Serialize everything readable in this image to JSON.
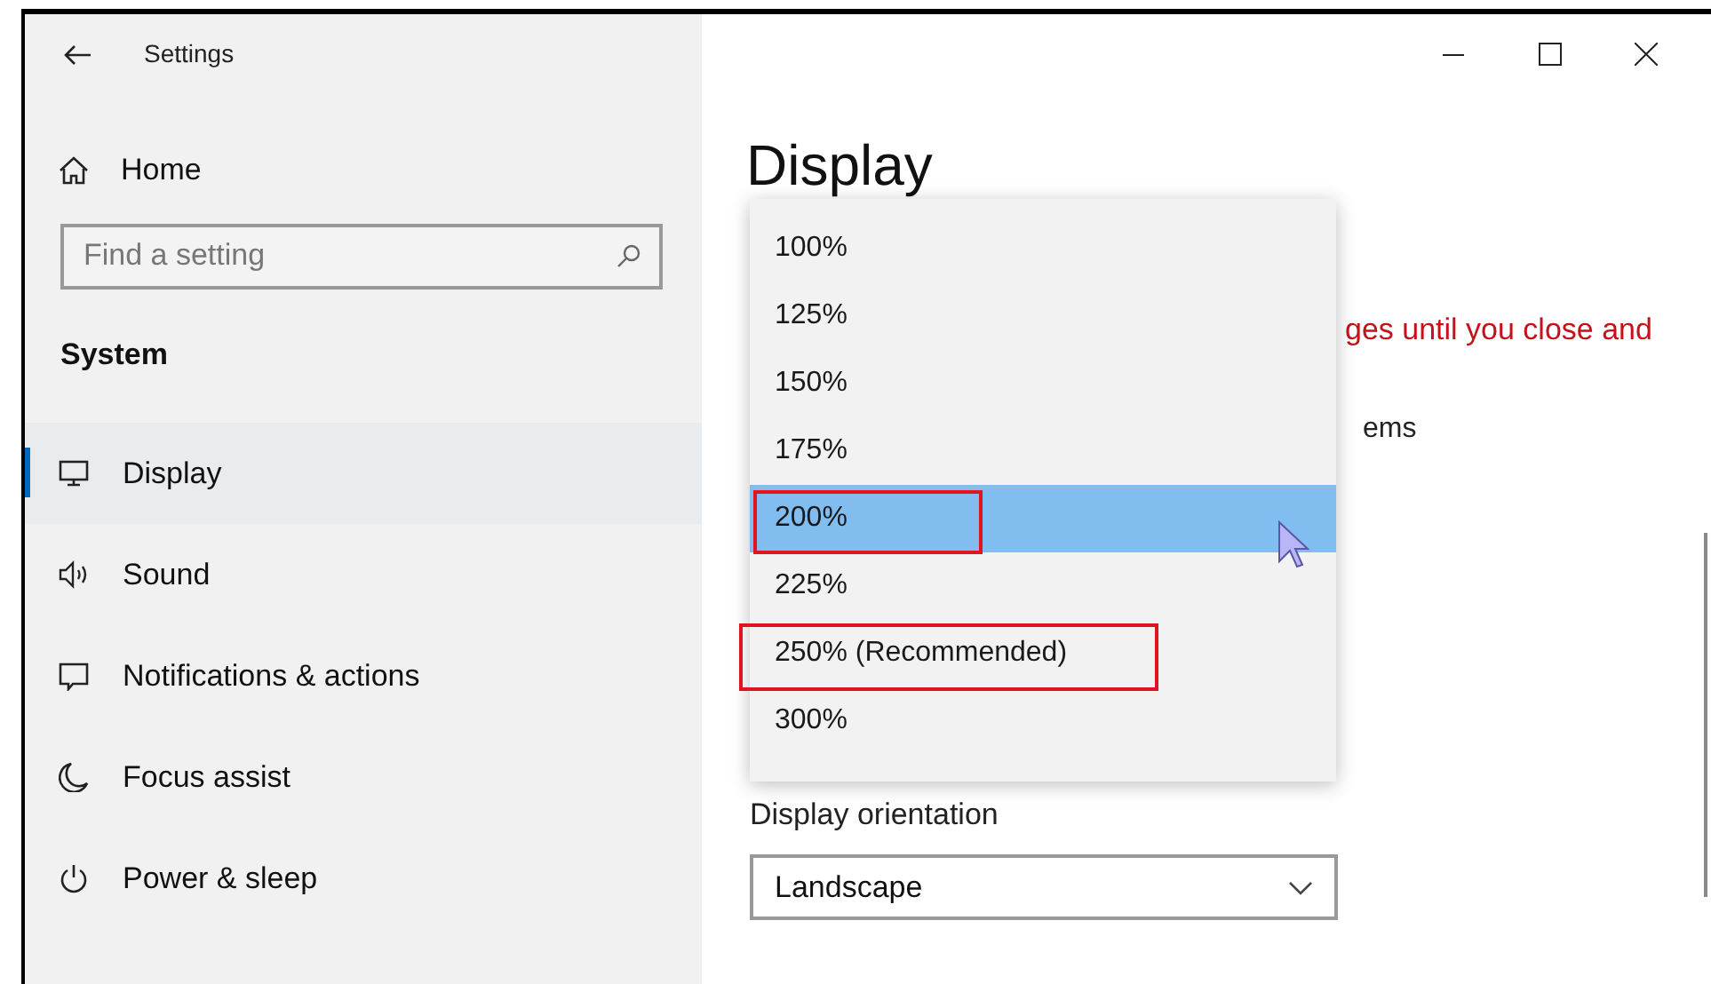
{
  "window": {
    "title": "Settings"
  },
  "sidebar": {
    "home": "Home",
    "search": {
      "placeholder": "Find a setting"
    },
    "section": "System",
    "items": [
      {
        "label": "Display",
        "selected": true
      },
      {
        "label": "Sound",
        "selected": false
      },
      {
        "label": "Notifications & actions",
        "selected": false
      },
      {
        "label": "Focus assist",
        "selected": false
      },
      {
        "label": "Power & sleep",
        "selected": false
      }
    ]
  },
  "content": {
    "title": "Display",
    "notice": "ges until you close and",
    "fragment": "ems",
    "scale_dropdown": {
      "options": [
        {
          "label": "100%",
          "selected": false,
          "annotated": false
        },
        {
          "label": "125%",
          "selected": false,
          "annotated": false
        },
        {
          "label": "150%",
          "selected": false,
          "annotated": false
        },
        {
          "label": "175%",
          "selected": false,
          "annotated": false
        },
        {
          "label": "200%",
          "selected": true,
          "annotated": true
        },
        {
          "label": "225%",
          "selected": false,
          "annotated": false
        },
        {
          "label": "250% (Recommended)",
          "selected": false,
          "annotated": true
        },
        {
          "label": "300%",
          "selected": false,
          "annotated": false
        }
      ]
    },
    "orientation": {
      "label": "Display orientation",
      "value": "Landscape"
    }
  }
}
